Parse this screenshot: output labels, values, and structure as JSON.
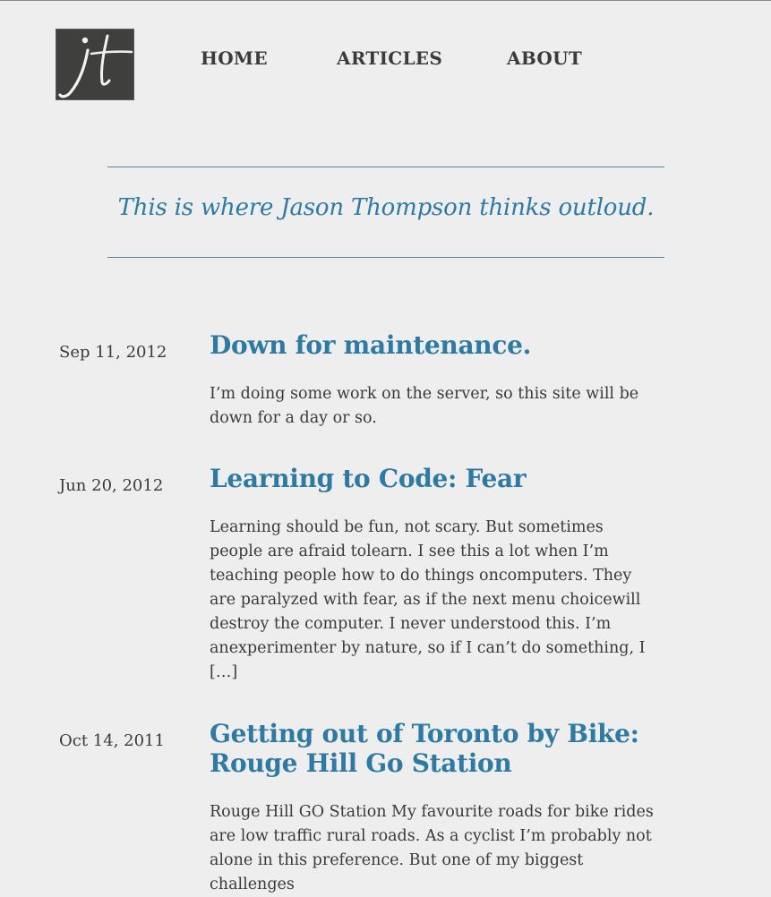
{
  "logo": {
    "text": "jt"
  },
  "nav": {
    "home": "HOME",
    "articles": "ARTICLES",
    "about": "ABOUT"
  },
  "tagline": "This is where Jason Thompson thinks outloud.",
  "posts": [
    {
      "date": "Sep 11, 2012",
      "title": "Down for maintenance.",
      "excerpt": "I’m doing some work on the server, so this site will be down for a day or so."
    },
    {
      "date": "Jun 20, 2012",
      "title": "Learning to Code: Fear",
      "excerpt": "Learning should be fun, not scary. But sometimes people are afraid tolearn. I see this a lot when I’m teaching people how to do things oncomputers. They are paralyzed with fear, as if the next menu choicewill destroy the computer. I never understood this. I’m anexperimenter by nature, so if I can’t do something, I […]"
    },
    {
      "date": "Oct 14, 2011",
      "title": "Getting out of Toronto by Bike: Rouge Hill Go Station",
      "excerpt": "Rouge Hill GO Station My favourite roads for bike rides are low traffic rural roads. As a cyclist I’m probably not alone in this preference. But one of my biggest challenges"
    }
  ],
  "colors": {
    "background": "#eeeeee",
    "accent": "#2e7aa3",
    "text": "#3a3a3a",
    "logo_bg": "#3f3f3d"
  }
}
